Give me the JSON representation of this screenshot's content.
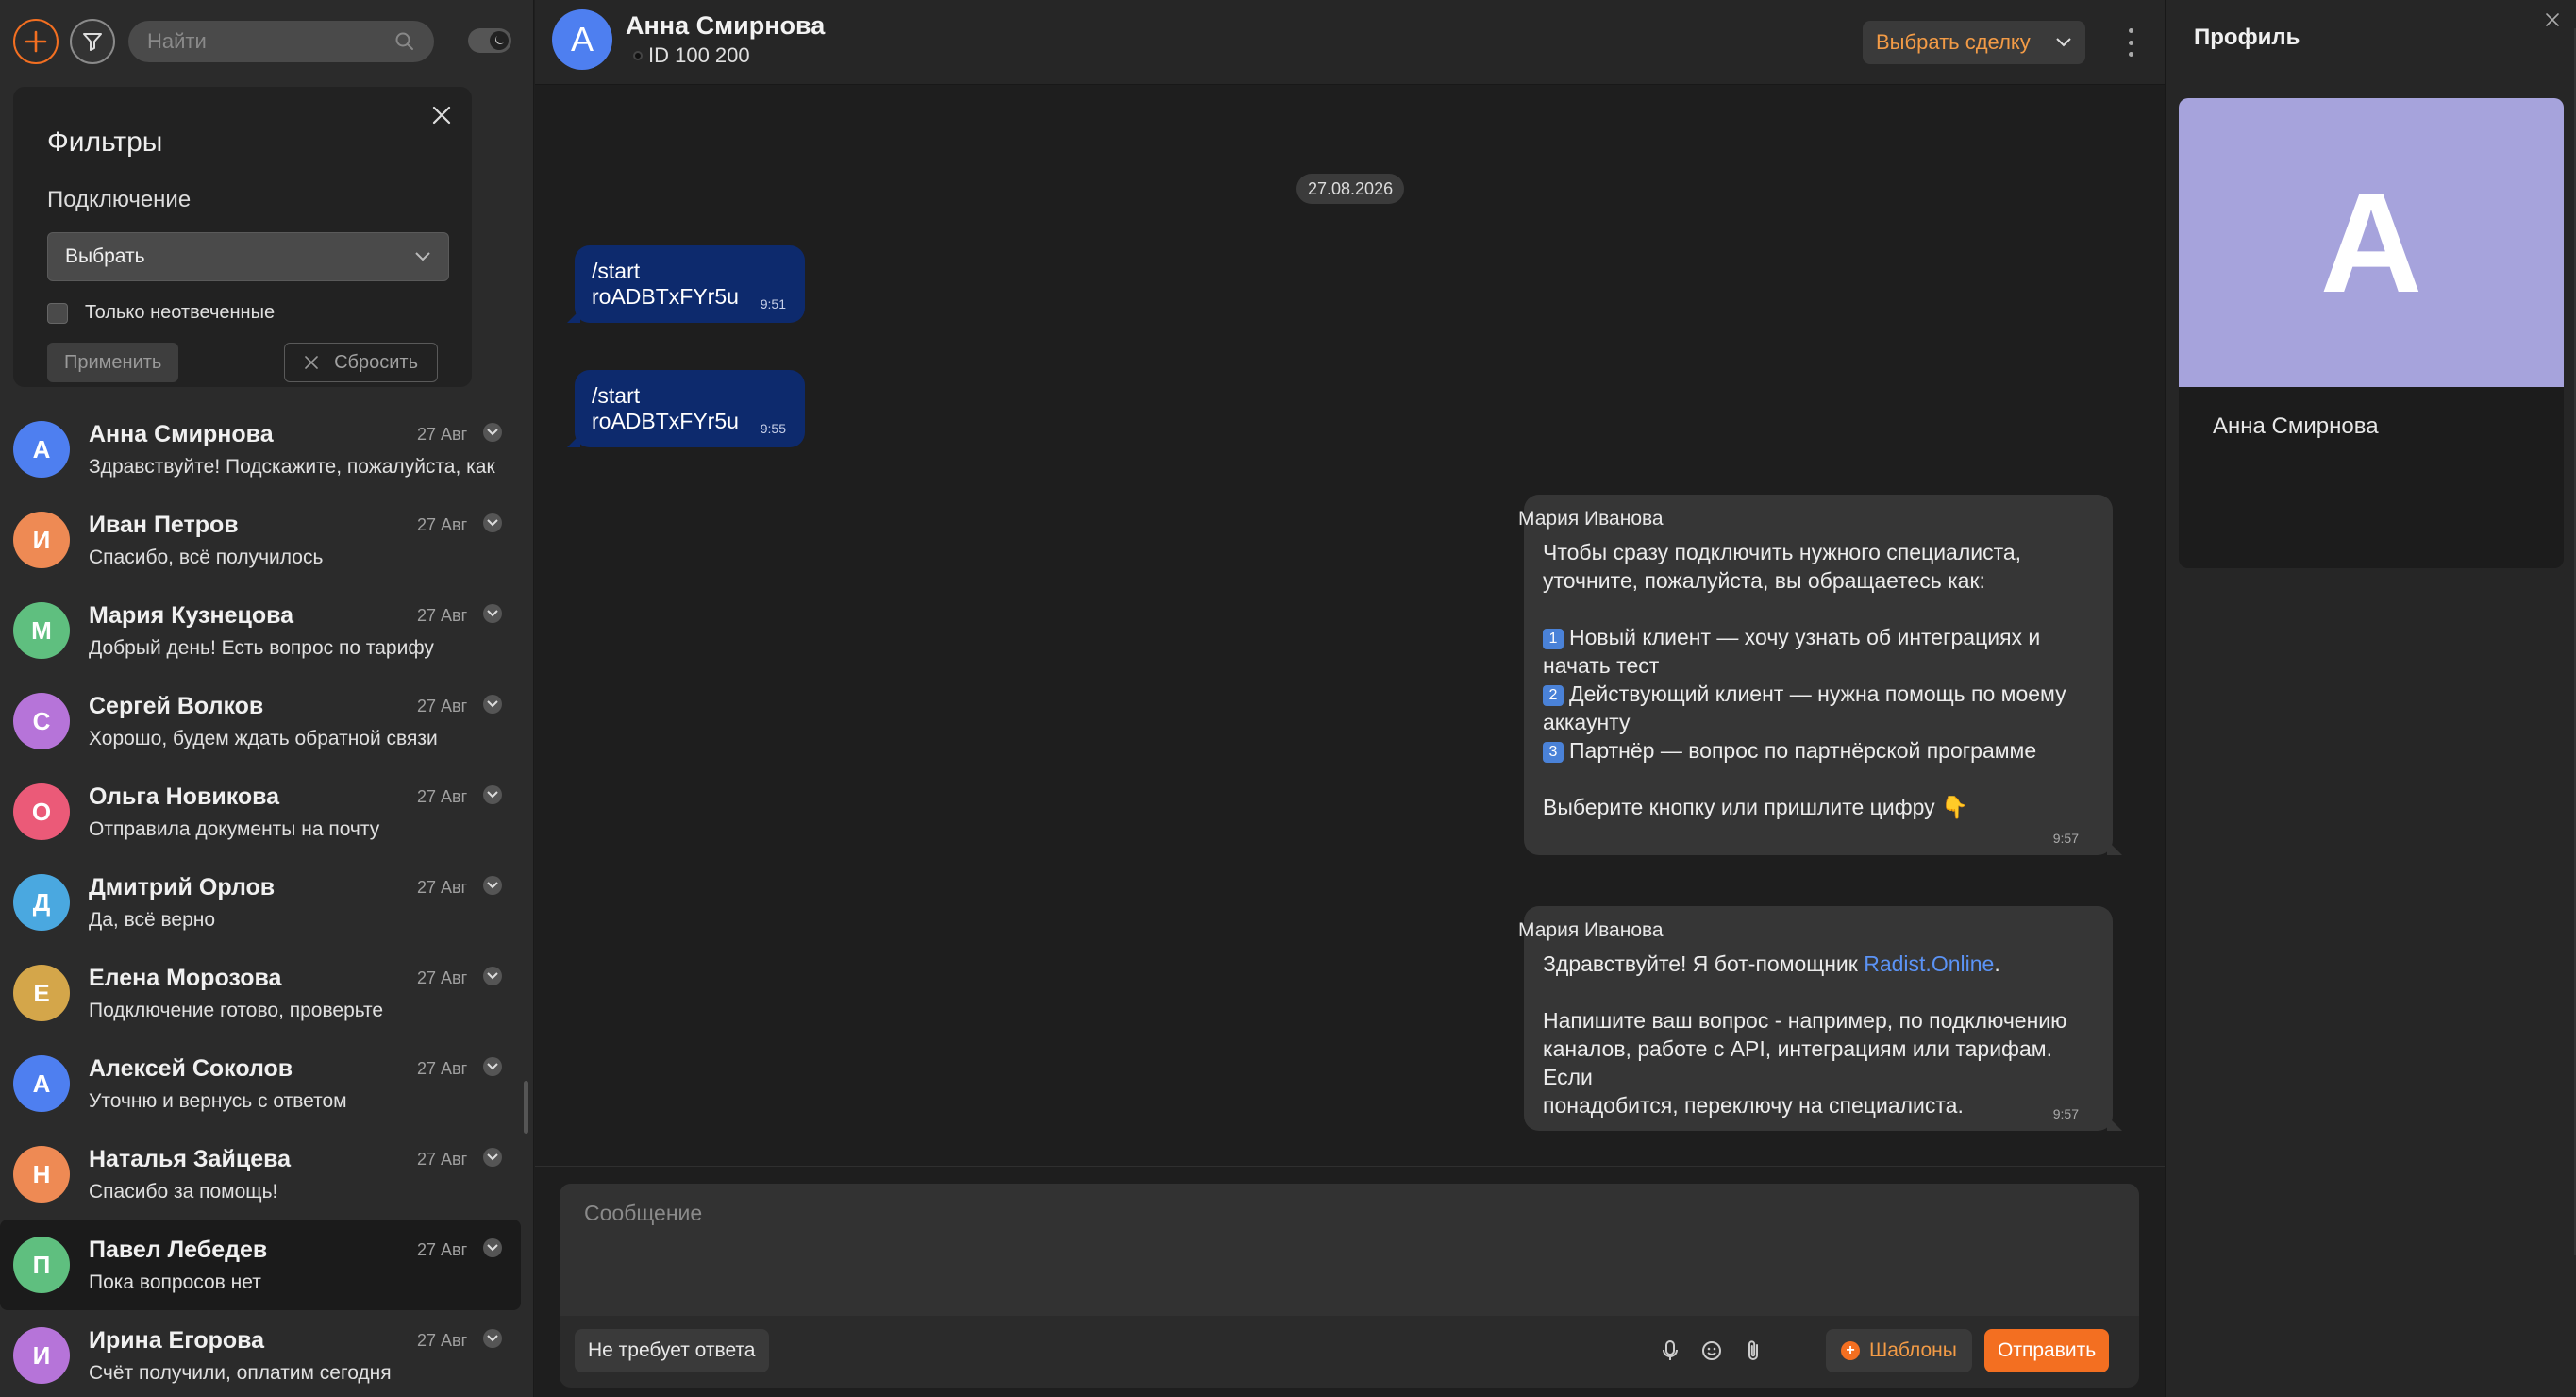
{
  "search": {
    "placeholder": "Найти"
  },
  "filters": {
    "title": "Фильтры",
    "connection_label": "Подключение",
    "connection_value": "Выбрать",
    "unanswered_label": "Только неотвеченные",
    "apply_label": "Применить",
    "reset_label": "Сбросить"
  },
  "chats": [
    {
      "initial": "А",
      "name": "Анна Смирнова",
      "preview": "Здравствуйте! Подскажите, пожалуйста, как",
      "date": "27 Авг",
      "color": "#4e7ff0"
    },
    {
      "initial": "И",
      "name": "Иван Петров",
      "preview": "Спасибо, всё получилось",
      "date": "27 Авг",
      "color": "#ee8a54"
    },
    {
      "initial": "М",
      "name": "Мария Кузнецова",
      "preview": "Добрый день! Есть вопрос по тарифу",
      "date": "27 Авг",
      "color": "#5fbf7f"
    },
    {
      "initial": "С",
      "name": "Сергей Волков",
      "preview": "Хорошо, будем ждать обратной связи",
      "date": "27 Авг",
      "color": "#b674d9"
    },
    {
      "initial": "О",
      "name": "Ольга Новикова",
      "preview": "Отправила документы на почту",
      "date": "27 Авг",
      "color": "#eb5a78"
    },
    {
      "initial": "Д",
      "name": "Дмитрий Орлов",
      "preview": "Да, всё верно",
      "date": "27 Авг",
      "color": "#4aa8e0"
    },
    {
      "initial": "Е",
      "name": "Елена Морозова",
      "preview": "Подключение готово, проверьте",
      "date": "27 Авг",
      "color": "#d4a64a"
    },
    {
      "initial": "А",
      "name": "Алексей Соколов",
      "preview": "Уточню и вернусь с ответом",
      "date": "27 Авг",
      "color": "#4e7ff0"
    },
    {
      "initial": "Н",
      "name": "Наталья Зайцева",
      "preview": "Спасибо за помощь!",
      "date": "27 Авг",
      "color": "#ee8a54"
    },
    {
      "initial": "П",
      "name": "Павел Лебедев",
      "preview": "Пока вопросов нет",
      "date": "27 Авг",
      "color": "#5fbf7f"
    },
    {
      "initial": "И",
      "name": "Ирина Егорова",
      "preview": "Счёт получили, оплатим сегодня",
      "date": "27 Авг",
      "color": "#b674d9"
    }
  ],
  "header": {
    "initial": "А",
    "name": "Анна Смирнова",
    "id_text": "ID 100 200",
    "deal_label": "Выбрать сделку"
  },
  "messages": {
    "date": "27.08.2026",
    "outgoing": [
      {
        "text": "/start roADBTxFYr5u",
        "time": "9:51"
      },
      {
        "text": "/start roADBTxFYr5u",
        "time": "9:55"
      }
    ],
    "incoming": [
      {
        "sender": "Мария Иванова",
        "intro": "Чтобы сразу подключить нужного специалиста,\nуточните, пожалуйста, вы обращаетесь как:",
        "options": [
          {
            "badge": "1",
            "text": "Новый клиент — хочу узнать об интеграциях и\nначать тест"
          },
          {
            "badge": "2",
            "text": "Действующий клиент — нужна помощь по моему\nаккаунту"
          },
          {
            "badge": "3",
            "text": "Партнёр — вопрос по партнёрской программе"
          }
        ],
        "outro": "Выберите кнопку или пришлите цифру 👇",
        "time": "9:57"
      },
      {
        "sender": "Мария Иванова",
        "line1_before": "Здравствуйте! Я бот-помощник ",
        "link": "Radist.Online",
        "line1_after": ".",
        "body": "Напишите ваш вопрос - например, по подключению\nканалов, работе с API, интеграциям или тарифам. Если\nпонадобится, переключу на специалиста.",
        "time": "9:57"
      }
    ]
  },
  "composer": {
    "placeholder": "Сообщение",
    "no_reply_label": "Не требует ответа",
    "templates_label": "Шаблоны",
    "send_label": "Отправить"
  },
  "profile": {
    "title": "Профиль",
    "initial": "А",
    "name": "Анна Смирнова"
  }
}
